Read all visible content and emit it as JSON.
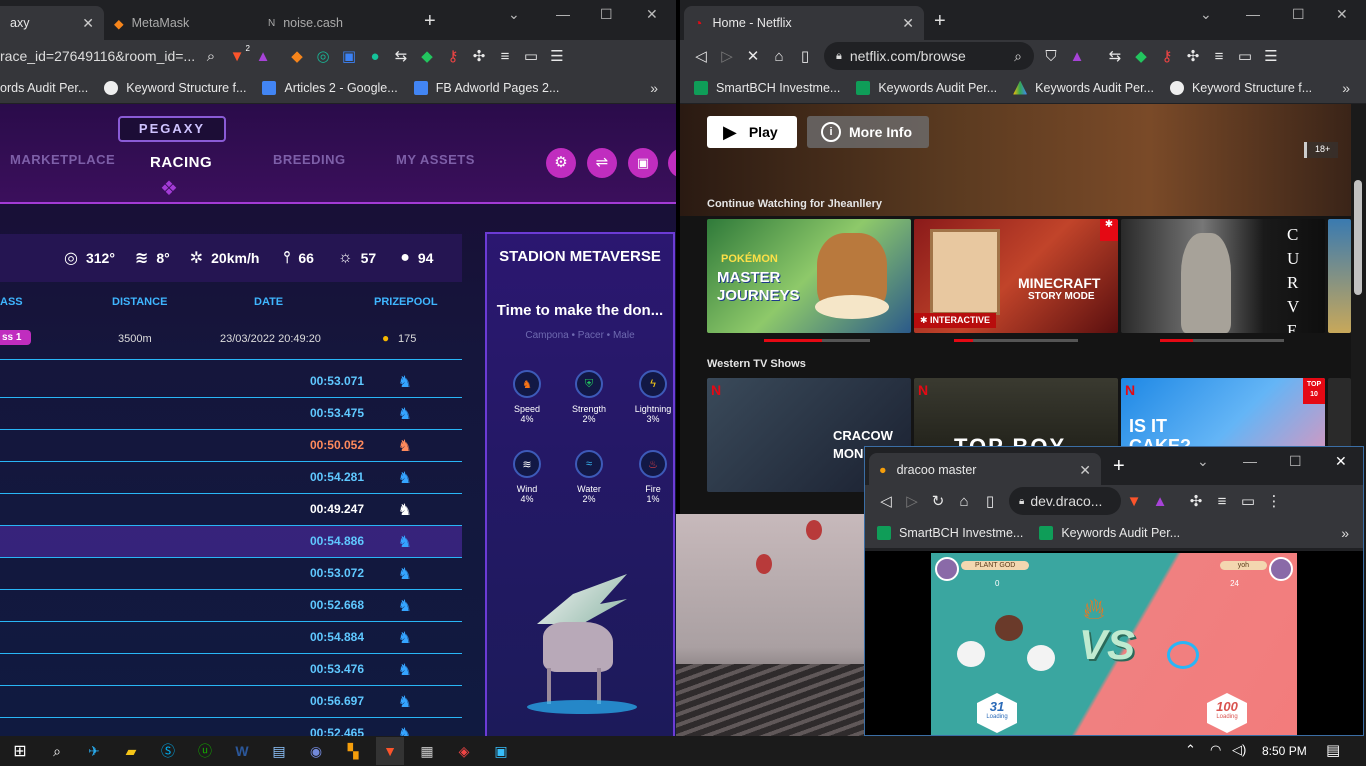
{
  "left_window": {
    "tabs": [
      {
        "label": "axy"
      },
      {
        "label": "MetaMask"
      },
      {
        "label": "noise.cash"
      }
    ],
    "url": "race_id=27649116&room_id=...",
    "bookmarks": [
      {
        "label": "ords Audit Per..."
      },
      {
        "label": "Keyword Structure f..."
      },
      {
        "label": "Articles 2 - Google..."
      },
      {
        "label": "FB Adworld Pages 2..."
      }
    ],
    "badge": "2",
    "more": "»"
  },
  "pegaxy": {
    "logo": "PEGAXY",
    "nav": [
      "MARKETPLACE",
      "RACING",
      "BREEDING",
      "MY ASSETS"
    ],
    "stats": [
      {
        "icon": "compass-icon",
        "value": "312°"
      },
      {
        "icon": "wind-icon",
        "value": "8°"
      },
      {
        "icon": "windspeed-icon",
        "value": "20km/h"
      },
      {
        "icon": "thermometer-icon",
        "value": "66"
      },
      {
        "icon": "sun-icon",
        "value": "57"
      },
      {
        "icon": "drop-icon",
        "value": "94"
      }
    ],
    "columns": [
      "ASS",
      "DISTANCE",
      "DATE",
      "PRIZEPOOL"
    ],
    "race": {
      "class": "ss 1",
      "distance": "3500m",
      "date": "23/03/2022 20:49:20",
      "prize": "175"
    },
    "times": [
      "00:53.071",
      "00:53.475",
      "00:50.052",
      "00:54.281",
      "00:49.247",
      "00:54.886",
      "00:53.072",
      "00:52.668",
      "00:54.884",
      "00:53.476",
      "00:56.697",
      "00:52.465"
    ],
    "side": {
      "title": "STADION METAVERSE",
      "subtitle": "Time to make the don...",
      "tags": "Campona  •  Pacer  •  Male",
      "attrs": [
        {
          "label": "Speed",
          "value": "4%"
        },
        {
          "label": "Strength",
          "value": "2%"
        },
        {
          "label": "Lightning",
          "value": "3%"
        },
        {
          "label": "Wind",
          "value": "4%"
        },
        {
          "label": "Water",
          "value": "2%"
        },
        {
          "label": "Fire",
          "value": "1%"
        }
      ]
    }
  },
  "right_window": {
    "tab": "Home - Netflix",
    "url": "netflix.com/browse",
    "bookmarks": [
      {
        "label": "SmartBCH Investme..."
      },
      {
        "label": "Keywords Audit Per..."
      },
      {
        "label": "Keywords Audit Per..."
      },
      {
        "label": "Keyword Structure f..."
      }
    ],
    "more": "»"
  },
  "netflix": {
    "play": "Play",
    "more_info": "More Info",
    "rating": "18+",
    "row1": "Continue Watching for Jheanllery",
    "row2": "Western TV Shows",
    "tiles1": [
      {
        "line1": "MASTER",
        "line2": "JOURNEYS",
        "progress": 0.55
      },
      {
        "line1": "MINECRAFT",
        "line2": "STORY MODE",
        "badge": "INTERACTIVE",
        "progress": 0.15
      },
      {
        "line1": "CURVE",
        "line2": "",
        "progress": 0.35
      }
    ],
    "tiles2": [
      {
        "line1": "CRACOW",
        "line2": "MON"
      },
      {
        "line1": "TOP BOY",
        "line2": ""
      },
      {
        "line1": "IS IT",
        "line2": "CAKE?",
        "top10": "TOP 10"
      }
    ]
  },
  "dracoo": {
    "tab": "dracoo master",
    "url": "dev.draco...",
    "bookmarks": [
      {
        "label": "SmartBCH Investme..."
      },
      {
        "label": "Keywords Audit Per..."
      }
    ],
    "more": "»",
    "player1": "PLANT GOD",
    "player1_score": "0",
    "player2": "yoh",
    "player2_score": "24",
    "vs": "VS",
    "hp1": "31",
    "hp2": "100",
    "hp_label": "Loading"
  },
  "taskbar": {
    "time": "8:50 PM"
  }
}
